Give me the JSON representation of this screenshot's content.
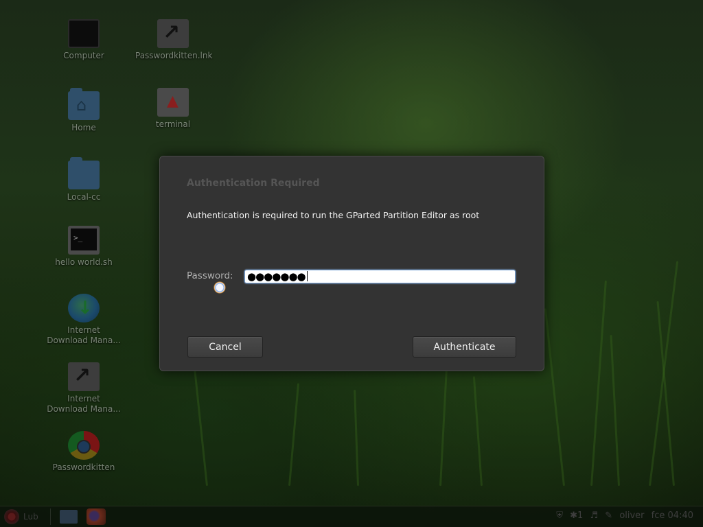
{
  "desktop": {
    "icons": [
      {
        "label": "Computer"
      },
      {
        "label": "Passwordkitten.lnk"
      },
      {
        "label": "Home"
      },
      {
        "label": "terminal"
      },
      {
        "label": "Local-cc"
      },
      {
        "label": "hello world.sh"
      },
      {
        "label": "Internet Download Mana..."
      },
      {
        "label": "Internet Download Mana..."
      },
      {
        "label": "Passwordkitten"
      }
    ]
  },
  "dialog": {
    "title": "Authentication Required",
    "message": "Authentication is required to run the GParted Partition Editor as root",
    "password_label": "Password:",
    "password_value": "●●●●●●●",
    "cancel_label": "Cancel",
    "authenticate_label": "Authenticate"
  },
  "taskbar": {
    "menu_label": "Lub",
    "user_label": "oliver",
    "clock": "fce 04:40"
  },
  "colors": {
    "dialog_bg": "#333333",
    "input_focus_border": "#7aa3d6",
    "desktop_green": "#1f3418"
  }
}
